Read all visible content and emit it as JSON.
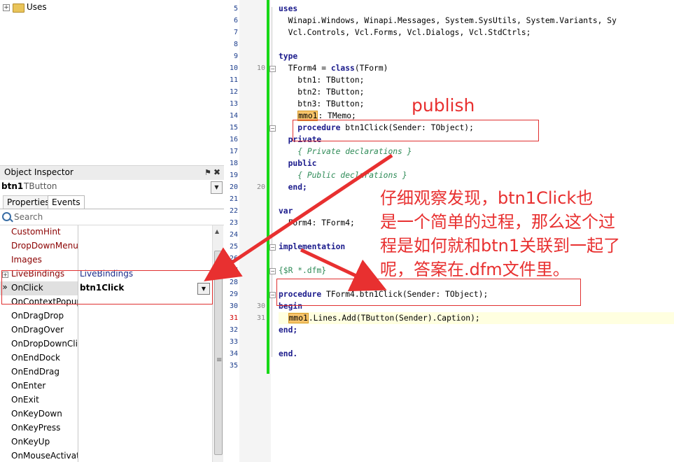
{
  "tree": {
    "node_label": "Uses",
    "expander": "+"
  },
  "object_inspector": {
    "title": "Object Inspector",
    "pin_glyph": "⚑",
    "close_glyph": "✖",
    "selected_name": "btn1",
    "selected_type": "TButton",
    "tabs": [
      "Properties",
      "Events"
    ],
    "search_placeholder": "Search",
    "rows": [
      {
        "name": "CustomHint",
        "value": ""
      },
      {
        "name": "DropDownMenu",
        "value": ""
      },
      {
        "name": "Images",
        "value": ""
      },
      {
        "name": "LiveBindings",
        "value": "LiveBindings"
      },
      {
        "name": "OnClick",
        "value": "btn1Click"
      },
      {
        "name": "OnContextPopup",
        "value": ""
      },
      {
        "name": "OnDragDrop",
        "value": ""
      },
      {
        "name": "OnDragOver",
        "value": ""
      },
      {
        "name": "OnDropDownClick",
        "value": ""
      },
      {
        "name": "OnEndDock",
        "value": ""
      },
      {
        "name": "OnEndDrag",
        "value": ""
      },
      {
        "name": "OnEnter",
        "value": ""
      },
      {
        "name": "OnExit",
        "value": ""
      },
      {
        "name": "OnKeyDown",
        "value": ""
      },
      {
        "name": "OnKeyPress",
        "value": ""
      },
      {
        "name": "OnKeyUp",
        "value": ""
      },
      {
        "name": "OnMouseActivate",
        "value": ""
      }
    ],
    "selected_marker": "»"
  },
  "editor": {
    "line_numbers": [
      "5",
      "6",
      "7",
      "8",
      "9",
      "10",
      "11",
      "12",
      "13",
      "14",
      "15",
      "16",
      "17",
      "18",
      "19",
      "20",
      "21",
      "22",
      "23",
      "24",
      "25",
      "26",
      "27",
      "28",
      "29",
      "30",
      "31",
      "32",
      "33",
      "34",
      "35"
    ],
    "secondary_numbers": [
      {
        "line": "10",
        "label": "10"
      },
      {
        "line": "20",
        "label": "20"
      },
      {
        "line": "30",
        "label": "30"
      },
      {
        "line": "31",
        "label": "31"
      }
    ],
    "code": {
      "l5": "uses",
      "l6": "  Winapi.Windows, Winapi.Messages, System.SysUtils, System.Variants, Sy",
      "l7": "  Vcl.Controls, Vcl.Forms, Vcl.Dialogs, Vcl.StdCtrls;",
      "l9": "type",
      "l10a": "  TForm4 = ",
      "l10kw": "class",
      "l10b": "(TForm)",
      "l11": "    btn1: TButton;",
      "l12": "    btn2: TButton;",
      "l13": "    btn3: TButton;",
      "l14m": "mmo1",
      "l14b": ": TMemo;",
      "l15kw": "procedure",
      "l15b": " btn1Click(Sender: TObject);",
      "l16": "private",
      "l17": "{ Private declarations }",
      "l18": "public",
      "l19": "{ Public declarations }",
      "l20": "end;",
      "l22": "var",
      "l23": "  Form4: TForm4;",
      "l25": "implementation",
      "l27": "{$R *.dfm}",
      "l29kw": "procedure",
      "l29b": " TForm4.btn1Click(Sender: TObject);",
      "l30": "begin",
      "l31m": "mmo1",
      "l31b": ".Lines.Add(TButton(Sender).Caption);",
      "l32": "end;",
      "l34": "end."
    }
  },
  "annotations": {
    "publish_label": "publish",
    "explanation_lines": [
      "仔细观察发现，btn1Click也",
      "是一个简单的过程，那么这个过",
      "程是如何就和btn1关联到一起了",
      "呢，答案在.dfm文件里。"
    ],
    "color": "#e83030"
  }
}
